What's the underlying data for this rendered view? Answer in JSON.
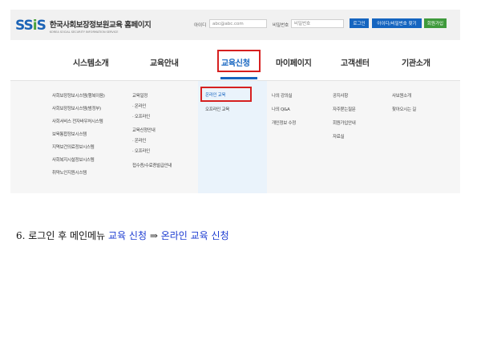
{
  "header": {
    "logo_mark": [
      "SS",
      "i",
      "S"
    ],
    "title": "한국사회보장정보원교육 홈페이지",
    "subtitle": "KOREA SOCIAL SECURITY INFORMATION SERVICE",
    "id_label": "아이디",
    "id_placeholder": "abc@abc.com",
    "pw_label": "비밀번호",
    "pw_placeholder": "비밀번호",
    "login_button": "로그인",
    "find_button": "아이디/비밀번호 찾기",
    "join_button": "회원가입"
  },
  "nav": {
    "items": [
      "시스템소개",
      "교육안내",
      "교육신청",
      "마이페이지",
      "고객센터",
      "기관소개"
    ],
    "active_index": 2
  },
  "submenu": {
    "col1": [
      "사회보장정보시스템(행복이음)",
      "사회보장정보시스템(범정부)",
      "사회서비스 전자바우처시스템",
      "보육통합정보시스템",
      "지역보건의료정보시스템",
      "사회복지시설정보시스템",
      "취약노인지원시스템"
    ],
    "col2": [
      "교육일정",
      "· 온라인",
      "· 오프라인",
      "교육신청안내",
      "· 온라인",
      "· 오프라인",
      "접수증/수료증발급안내"
    ],
    "col3": [
      "온라인 교육",
      "오프라인 교육"
    ],
    "col4": [
      "나의 강의실",
      "나의 Q&A",
      "개인정보 수정"
    ],
    "col5": [
      "공지사항",
      "자주묻는질문",
      "회원가입안내",
      "자료실"
    ],
    "col6": [
      "사보원소개",
      "찾아오시는 길"
    ]
  },
  "caption": {
    "prefix": "6. 로그인 후 메인메뉴 ",
    "menu": "교육 신청",
    "arrow": " ⇒ ",
    "target": "온라인 교육 신청"
  },
  "colors": {
    "accent": "#1565c0",
    "highlight_box": "#d62020",
    "join_button": "#3f9a3c",
    "caption_highlight": "#1b3bd1"
  }
}
